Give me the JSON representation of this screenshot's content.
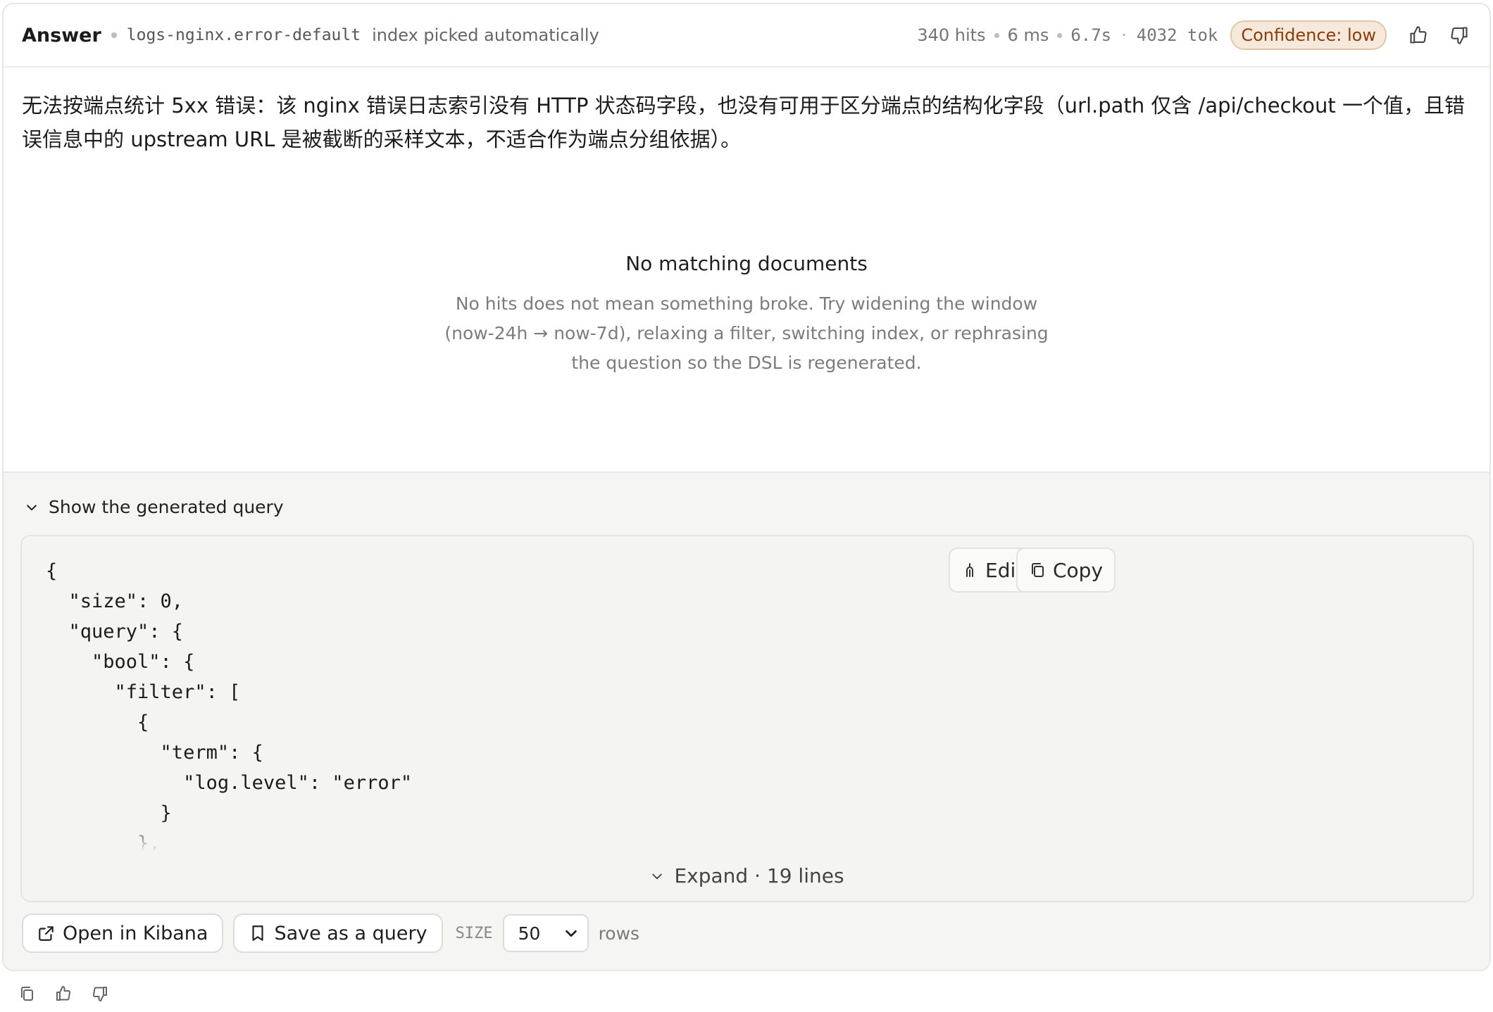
{
  "header": {
    "title": "Answer",
    "index_name": "logs-nginx.error-default",
    "index_note": "index picked automatically",
    "hits": "340 hits",
    "latency": "6 ms",
    "duration": "6.7s",
    "tokens": "4032 tok",
    "confidence": "Confidence: low"
  },
  "answer": {
    "text": "无法按端点统计 5xx 错误：该 nginx 错误日志索引没有 HTTP 状态码字段，也没有可用于区分端点的结构化字段（url.path 仅含 /api/checkout 一个值，且错误信息中的 upstream URL 是被截断的采样文本，不适合作为端点分组依据）。"
  },
  "empty_state": {
    "title": "No matching documents",
    "description": "No hits does not mean something broke. Try widening the window (now-24h → now-7d), relaxing a filter, switching index, or rephrasing the question so the DSL is regenerated."
  },
  "query_section": {
    "toggle_label": "Show the generated query",
    "code": "{\n  \"size\": 0,\n  \"query\": {\n    \"bool\": {\n      \"filter\": [\n        {\n          \"term\": {\n            \"log.level\": \"error\"\n          }\n        },",
    "edit_label": "Edit",
    "copy_label": "Copy",
    "expand_label": "Expand · 19 lines"
  },
  "actions": {
    "open_kibana": "Open in Kibana",
    "save_query": "Save as a query",
    "size_label": "SIZE",
    "size_value": "50",
    "rows_label": "rows"
  },
  "colors": {
    "badge_bg": "#f6e9dc",
    "badge_text": "#8a3d0a",
    "panel_bg": "#f5f5f4"
  },
  "icons": [
    "thumbs-up-icon",
    "thumbs-down-icon",
    "chevron-down-icon",
    "edit-icon",
    "copy-icon",
    "external-link-icon",
    "bookmark-icon"
  ]
}
